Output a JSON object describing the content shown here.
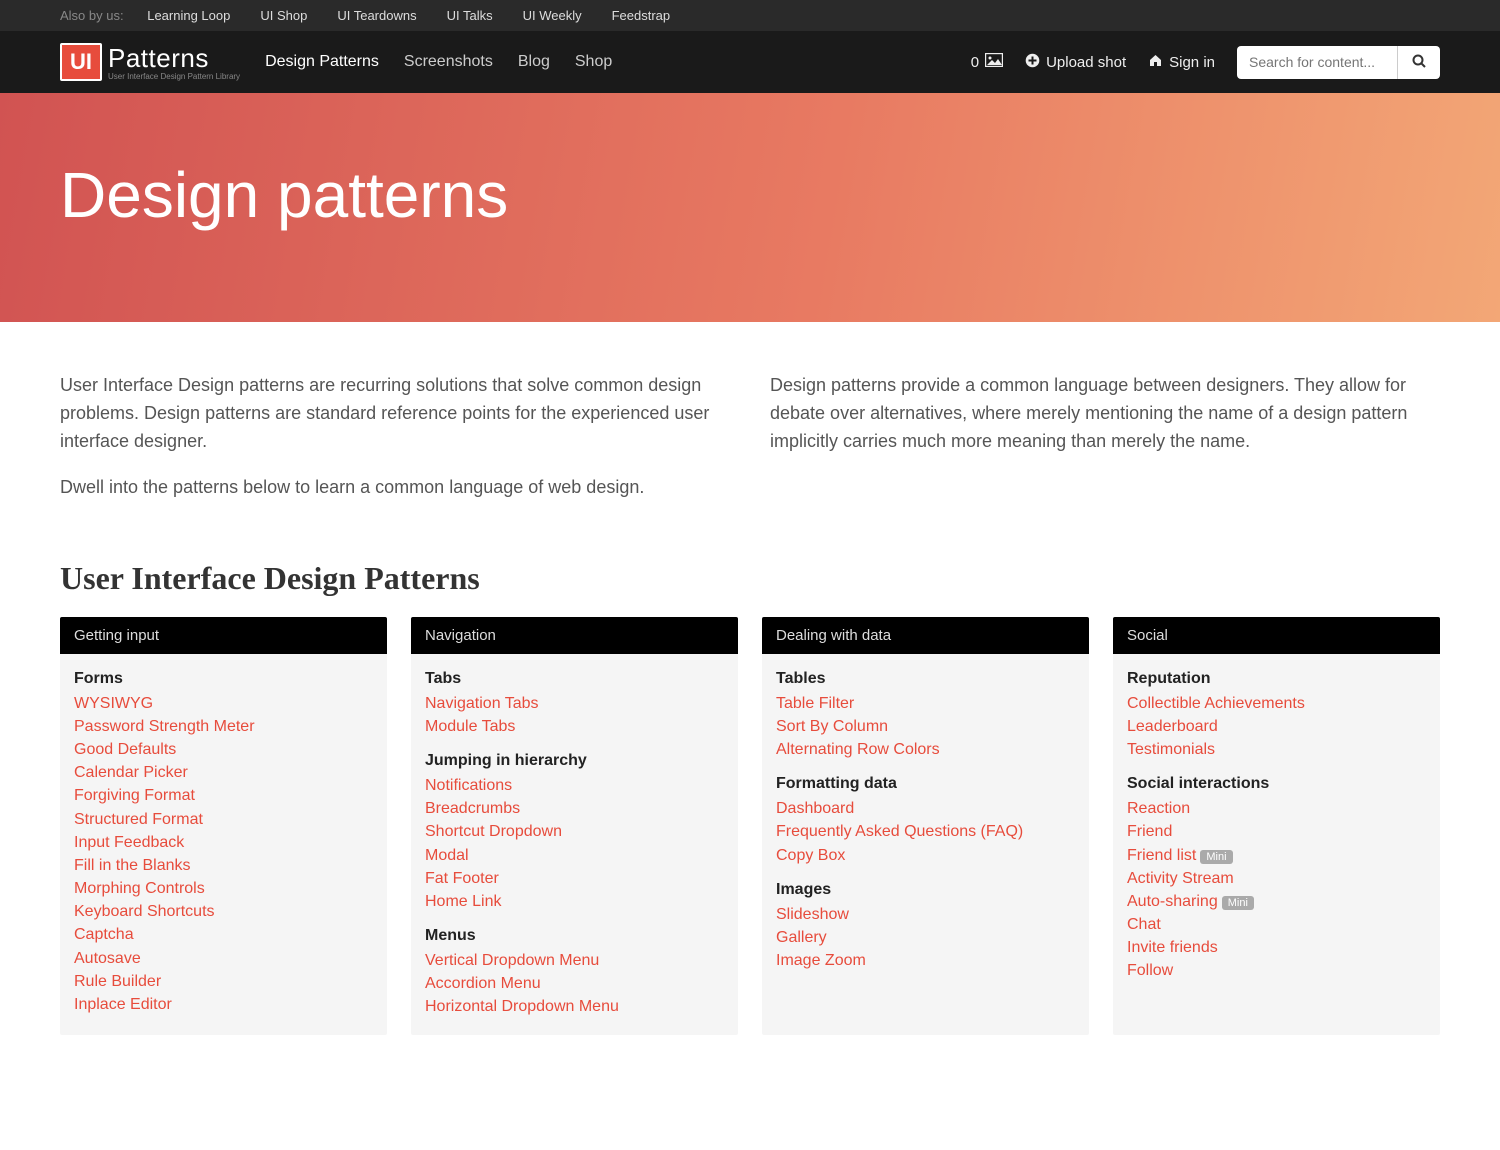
{
  "topbar": {
    "label": "Also by us:",
    "links": [
      "Learning Loop",
      "UI Shop",
      "UI Teardowns",
      "UI Talks",
      "UI Weekly",
      "Feedstrap"
    ]
  },
  "nav": {
    "logo_box": "UI",
    "logo_text": "Patterns",
    "logo_sub": "User Interface Design Pattern Library",
    "links": [
      {
        "label": "Design Patterns",
        "active": true
      },
      {
        "label": "Screenshots",
        "active": false
      },
      {
        "label": "Blog",
        "active": false
      },
      {
        "label": "Shop",
        "active": false
      }
    ],
    "counter_value": "0",
    "upload_label": "Upload shot",
    "signin_label": "Sign in",
    "search_placeholder": "Search for content..."
  },
  "hero": {
    "title": "Design patterns"
  },
  "intro": {
    "left": [
      "User Interface Design patterns are recurring solutions that solve common design problems. Design patterns are standard reference points for the experienced user interface designer.",
      "Dwell into the patterns below to learn a common language of web design."
    ],
    "right": [
      "Design patterns provide a common language between designers. They allow for debate over alternatives, where merely mentioning the name of a design pattern implicitly carries much more meaning than merely the name."
    ]
  },
  "section_title": "User Interface Design Patterns",
  "columns": [
    {
      "header": "Getting input",
      "groups": [
        {
          "title": "Forms",
          "items": [
            {
              "label": "WYSIWYG"
            },
            {
              "label": "Password Strength Meter"
            },
            {
              "label": "Good Defaults"
            },
            {
              "label": "Calendar Picker"
            },
            {
              "label": "Forgiving Format"
            },
            {
              "label": "Structured Format"
            },
            {
              "label": "Input Feedback"
            },
            {
              "label": "Fill in the Blanks"
            },
            {
              "label": "Morphing Controls"
            },
            {
              "label": "Keyboard Shortcuts"
            },
            {
              "label": "Captcha"
            },
            {
              "label": "Autosave"
            },
            {
              "label": "Rule Builder"
            },
            {
              "label": "Inplace Editor"
            }
          ]
        }
      ]
    },
    {
      "header": "Navigation",
      "groups": [
        {
          "title": "Tabs",
          "items": [
            {
              "label": "Navigation Tabs"
            },
            {
              "label": "Module Tabs"
            }
          ]
        },
        {
          "title": "Jumping in hierarchy",
          "items": [
            {
              "label": "Notifications"
            },
            {
              "label": "Breadcrumbs"
            },
            {
              "label": "Shortcut Dropdown"
            },
            {
              "label": "Modal"
            },
            {
              "label": "Fat Footer"
            },
            {
              "label": "Home Link"
            }
          ]
        },
        {
          "title": "Menus",
          "items": [
            {
              "label": "Vertical Dropdown Menu"
            },
            {
              "label": "Accordion Menu"
            },
            {
              "label": "Horizontal Dropdown Menu"
            }
          ]
        }
      ]
    },
    {
      "header": "Dealing with data",
      "groups": [
        {
          "title": "Tables",
          "items": [
            {
              "label": "Table Filter"
            },
            {
              "label": "Sort By Column"
            },
            {
              "label": "Alternating Row Colors"
            }
          ]
        },
        {
          "title": "Formatting data",
          "items": [
            {
              "label": "Dashboard"
            },
            {
              "label": "Frequently Asked Questions (FAQ)"
            },
            {
              "label": "Copy Box"
            }
          ]
        },
        {
          "title": "Images",
          "items": [
            {
              "label": "Slideshow"
            },
            {
              "label": "Gallery"
            },
            {
              "label": "Image Zoom"
            }
          ]
        }
      ]
    },
    {
      "header": "Social",
      "groups": [
        {
          "title": "Reputation",
          "items": [
            {
              "label": "Collectible Achievements"
            },
            {
              "label": "Leaderboard"
            },
            {
              "label": "Testimonials"
            }
          ]
        },
        {
          "title": "Social interactions",
          "items": [
            {
              "label": "Reaction"
            },
            {
              "label": "Friend"
            },
            {
              "label": "Friend list",
              "badge": "Mini"
            },
            {
              "label": "Activity Stream"
            },
            {
              "label": "Auto-sharing",
              "badge": "Mini"
            },
            {
              "label": "Chat"
            },
            {
              "label": "Invite friends"
            },
            {
              "label": "Follow"
            }
          ]
        }
      ]
    }
  ]
}
